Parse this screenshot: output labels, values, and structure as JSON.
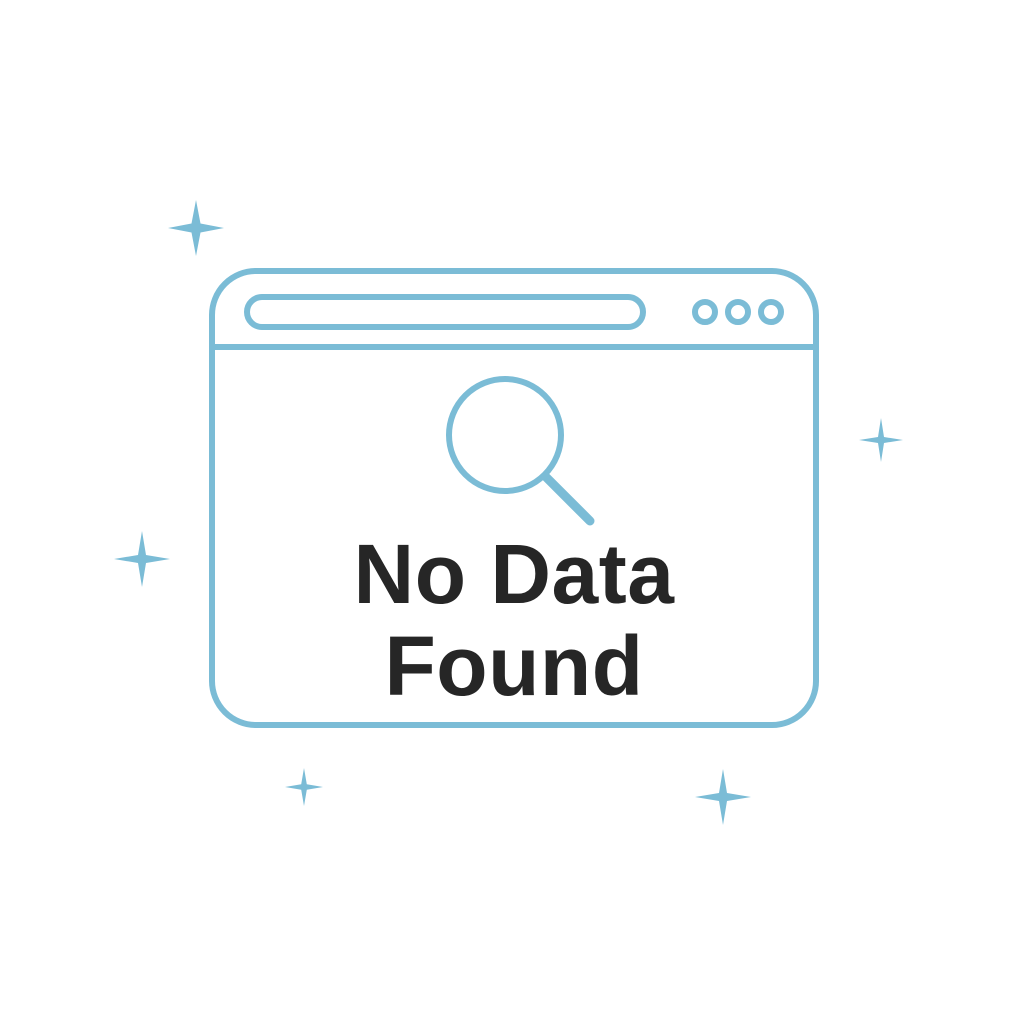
{
  "empty_state": {
    "title_line_1": "No Data",
    "title_line_2": "Found"
  },
  "icons": {
    "window": "browser-window-icon",
    "search": "magnifying-glass-icon",
    "sparkle": "sparkle-icon",
    "window_controls": "window-dots-icon"
  },
  "colors": {
    "accent": "#7bbcd6",
    "text": "#262626",
    "background": "#ffffff"
  }
}
